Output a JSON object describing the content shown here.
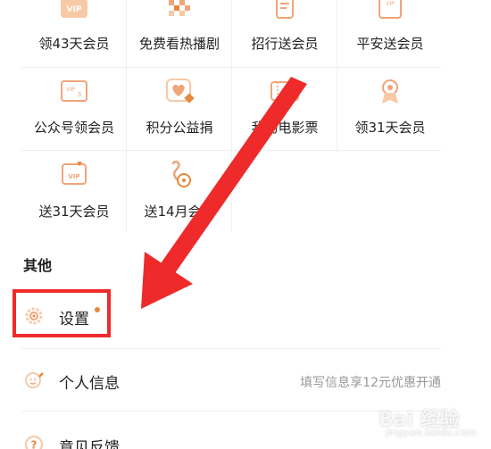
{
  "grid": {
    "items": [
      {
        "label": "领43天会员",
        "icon": "vip-ticket-icon"
      },
      {
        "label": "免费看热播剧",
        "icon": "checker-icon"
      },
      {
        "label": "招行送会员",
        "icon": "document-icon"
      },
      {
        "label": "平安送会员",
        "icon": "vip-card-icon"
      },
      {
        "label": "公众号领会员",
        "icon": "vip-card-icon"
      },
      {
        "label": "积分公益捐",
        "icon": "heart-icon"
      },
      {
        "label": "我的电影票",
        "icon": "movie-ticket-icon"
      },
      {
        "label": "领31天会员",
        "icon": "badge-icon"
      },
      {
        "label": "送31天会员",
        "icon": "vip-heart-icon"
      },
      {
        "label": "送14月会员",
        "icon": "gift-icon"
      }
    ]
  },
  "other": {
    "title": "其他",
    "items": [
      {
        "label": "设置",
        "icon": "gear-icon",
        "hint": ""
      },
      {
        "label": "个人信息",
        "icon": "profile-edit-icon",
        "hint": "填写信息享12元优惠开通"
      },
      {
        "label": "意见反馈",
        "icon": "help-icon",
        "hint": ""
      }
    ]
  },
  "colors": {
    "accent": "#e8883a",
    "annotation": "#ee2a2a"
  },
  "watermark": {
    "brand": "Bai 经验",
    "sub": "jingyan.baidu.com"
  }
}
